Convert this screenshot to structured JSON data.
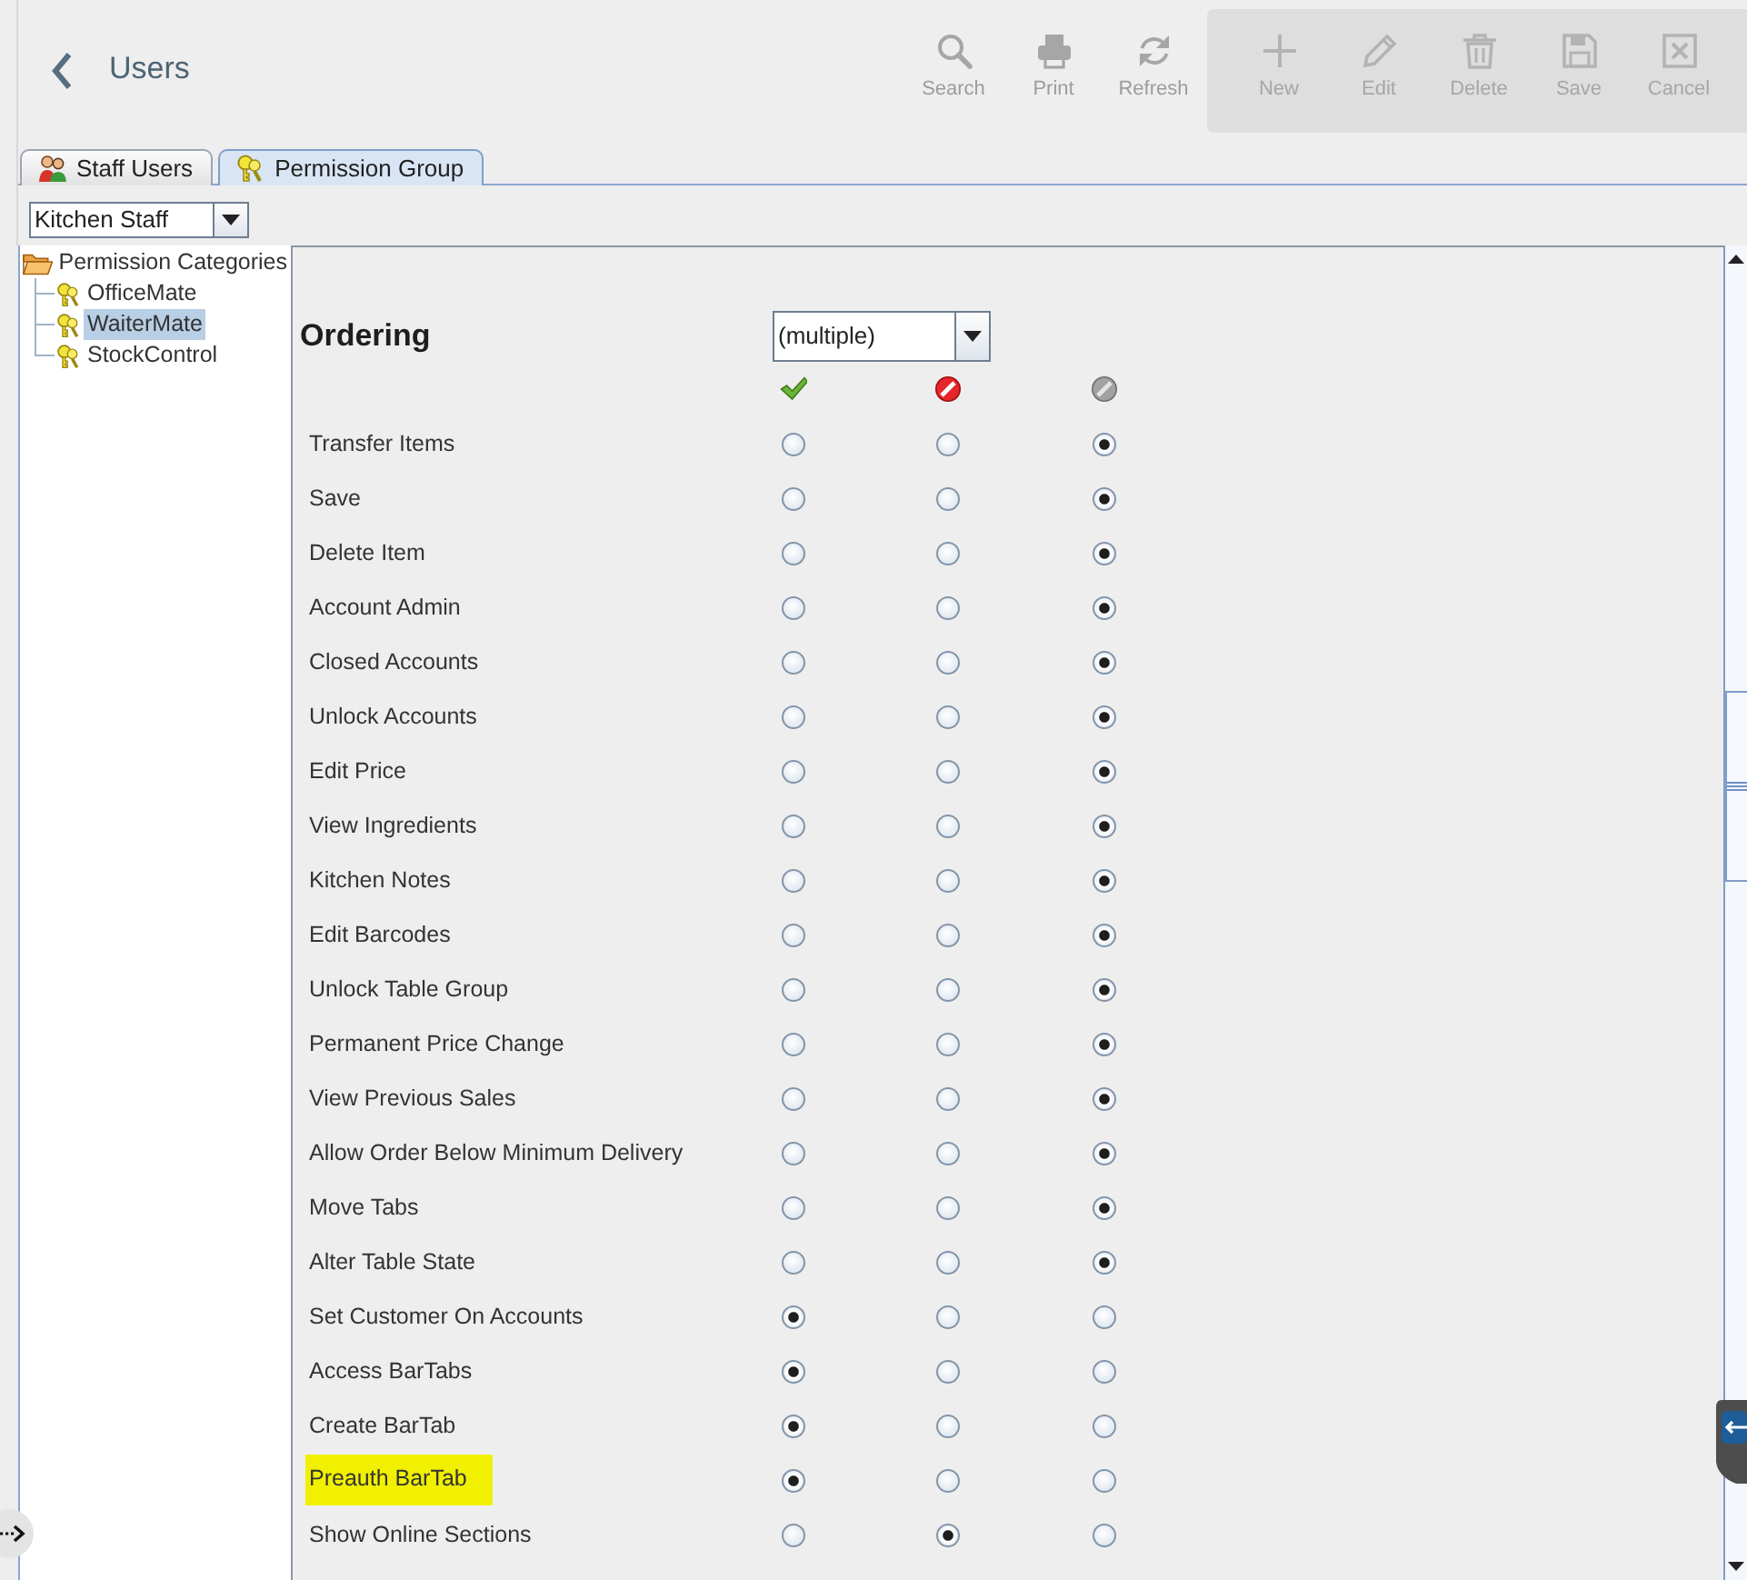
{
  "header": {
    "title": "Users"
  },
  "toolbar": {
    "groups": [
      {
        "kind": "plain",
        "buttons": [
          {
            "label": "Search",
            "kind": "search"
          },
          {
            "label": "Print",
            "kind": "print"
          },
          {
            "label": "Refresh",
            "kind": "refresh"
          }
        ]
      },
      {
        "kind": "panel",
        "buttons": [
          {
            "label": "New",
            "kind": "new"
          },
          {
            "label": "Edit",
            "kind": "edit"
          },
          {
            "label": "Delete",
            "kind": "delete"
          },
          {
            "label": "Save",
            "kind": "save"
          },
          {
            "label": "Cancel",
            "kind": "cancel"
          }
        ]
      }
    ]
  },
  "tabs": [
    {
      "label": "Staff Users",
      "kind": "users",
      "selected": false
    },
    {
      "label": "Permission Group",
      "kind": "group",
      "selected": true
    }
  ],
  "group_combo": {
    "value": "Kitchen Staff"
  },
  "tree": {
    "label": "Permission Categories",
    "expanded": true,
    "children": [
      {
        "label": "OfficeMate",
        "selected": false
      },
      {
        "label": "WaiterMate",
        "selected": true
      },
      {
        "label": "StockControl",
        "selected": false
      }
    ]
  },
  "section": {
    "title": "Ordering",
    "combo": {
      "value": "(multiple)"
    },
    "columns": [
      {
        "kind": "allow"
      },
      {
        "kind": "deny"
      },
      {
        "kind": "default"
      }
    ],
    "rows": [
      {
        "label": "Transfer Items",
        "highlighted": false,
        "options": [
          {
            "selected": false
          },
          {
            "selected": false
          },
          {
            "selected": true
          }
        ]
      },
      {
        "label": "Save",
        "highlighted": false,
        "options": [
          {
            "selected": false
          },
          {
            "selected": false
          },
          {
            "selected": true
          }
        ]
      },
      {
        "label": "Delete Item",
        "highlighted": false,
        "options": [
          {
            "selected": false
          },
          {
            "selected": false
          },
          {
            "selected": true
          }
        ]
      },
      {
        "label": "Account Admin",
        "highlighted": false,
        "options": [
          {
            "selected": false
          },
          {
            "selected": false
          },
          {
            "selected": true
          }
        ]
      },
      {
        "label": "Closed Accounts",
        "highlighted": false,
        "options": [
          {
            "selected": false
          },
          {
            "selected": false
          },
          {
            "selected": true
          }
        ]
      },
      {
        "label": "Unlock Accounts",
        "highlighted": false,
        "options": [
          {
            "selected": false
          },
          {
            "selected": false
          },
          {
            "selected": true
          }
        ]
      },
      {
        "label": "Edit Price",
        "highlighted": false,
        "options": [
          {
            "selected": false
          },
          {
            "selected": false
          },
          {
            "selected": true
          }
        ]
      },
      {
        "label": "View Ingredients",
        "highlighted": false,
        "options": [
          {
            "selected": false
          },
          {
            "selected": false
          },
          {
            "selected": true
          }
        ]
      },
      {
        "label": "Kitchen Notes",
        "highlighted": false,
        "options": [
          {
            "selected": false
          },
          {
            "selected": false
          },
          {
            "selected": true
          }
        ]
      },
      {
        "label": "Edit Barcodes",
        "highlighted": false,
        "options": [
          {
            "selected": false
          },
          {
            "selected": false
          },
          {
            "selected": true
          }
        ]
      },
      {
        "label": "Unlock Table Group",
        "highlighted": false,
        "options": [
          {
            "selected": false
          },
          {
            "selected": false
          },
          {
            "selected": true
          }
        ]
      },
      {
        "label": "Permanent Price Change",
        "highlighted": false,
        "options": [
          {
            "selected": false
          },
          {
            "selected": false
          },
          {
            "selected": true
          }
        ]
      },
      {
        "label": "View Previous Sales",
        "highlighted": false,
        "options": [
          {
            "selected": false
          },
          {
            "selected": false
          },
          {
            "selected": true
          }
        ]
      },
      {
        "label": "Allow Order Below Minimum Delivery",
        "highlighted": false,
        "options": [
          {
            "selected": false
          },
          {
            "selected": false
          },
          {
            "selected": true
          }
        ]
      },
      {
        "label": "Move Tabs",
        "highlighted": false,
        "options": [
          {
            "selected": false
          },
          {
            "selected": false
          },
          {
            "selected": true
          }
        ]
      },
      {
        "label": "Alter Table State",
        "highlighted": false,
        "options": [
          {
            "selected": false
          },
          {
            "selected": false
          },
          {
            "selected": true
          }
        ]
      },
      {
        "label": "Set Customer On Accounts",
        "highlighted": false,
        "options": [
          {
            "selected": true
          },
          {
            "selected": false
          },
          {
            "selected": false
          }
        ]
      },
      {
        "label": "Access BarTabs",
        "highlighted": false,
        "options": [
          {
            "selected": true
          },
          {
            "selected": false
          },
          {
            "selected": false
          }
        ]
      },
      {
        "label": "Create BarTab",
        "highlighted": false,
        "options": [
          {
            "selected": true
          },
          {
            "selected": false
          },
          {
            "selected": false
          }
        ]
      },
      {
        "label": "Preauth BarTab",
        "highlighted": true,
        "options": [
          {
            "selected": true
          },
          {
            "selected": false
          },
          {
            "selected": false
          }
        ]
      },
      {
        "label": "Show Online Sections",
        "highlighted": false,
        "options": [
          {
            "selected": false
          },
          {
            "selected": true
          },
          {
            "selected": false
          }
        ]
      }
    ]
  }
}
